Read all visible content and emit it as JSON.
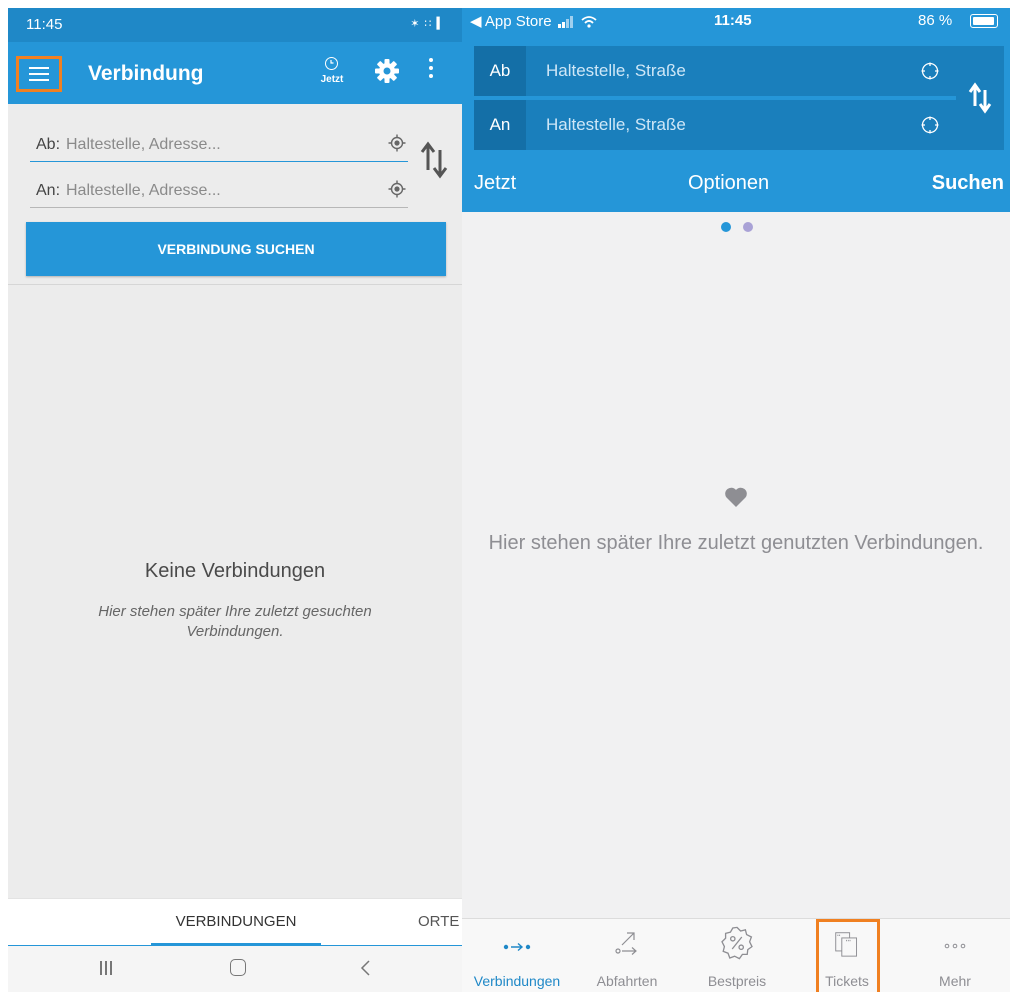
{
  "android": {
    "status": {
      "time": "11:45",
      "icons": "✶ ∷ ▍"
    },
    "toolbar": {
      "title": "Verbindung",
      "jetzt_label": "Jetzt"
    },
    "form": {
      "from_prefix": "Ab:",
      "from_placeholder": "Haltestelle, Adresse...",
      "to_prefix": "An:",
      "to_placeholder": "Haltestelle, Adresse...",
      "search_button": "VERBINDUNG SUCHEN"
    },
    "empty": {
      "title": "Keine Verbindungen",
      "subtitle": "Hier stehen später Ihre zuletzt gesuchten Verbindungen."
    },
    "tabs": [
      "VERBINDUNGEN",
      "ORTE"
    ]
  },
  "ios": {
    "status": {
      "back": "◀ App Store",
      "time": "11:45",
      "battery": "86 %"
    },
    "form": {
      "from_prefix": "Ab",
      "from_placeholder": "Haltestelle, Straße",
      "to_prefix": "An",
      "to_placeholder": "Haltestelle, Straße"
    },
    "actions": {
      "now": "Jetzt",
      "options": "Optionen",
      "search": "Suchen"
    },
    "empty": {
      "text": "Hier stehen später Ihre zuletzt genutzten Verbindungen."
    },
    "tabbar": [
      {
        "label": "Verbindungen",
        "icon": "connections-icon",
        "active": true
      },
      {
        "label": "Abfahrten",
        "icon": "departures-icon",
        "active": false
      },
      {
        "label": "Bestpreis",
        "icon": "best-price-icon",
        "active": false
      },
      {
        "label": "Tickets",
        "icon": "tickets-icon",
        "active": false
      },
      {
        "label": "Mehr",
        "icon": "more-icon",
        "active": false
      }
    ]
  },
  "colors": {
    "brand_blue": "#2596d8",
    "highlight_orange": "#f08021",
    "ios_inactive": "#8e8e93"
  }
}
